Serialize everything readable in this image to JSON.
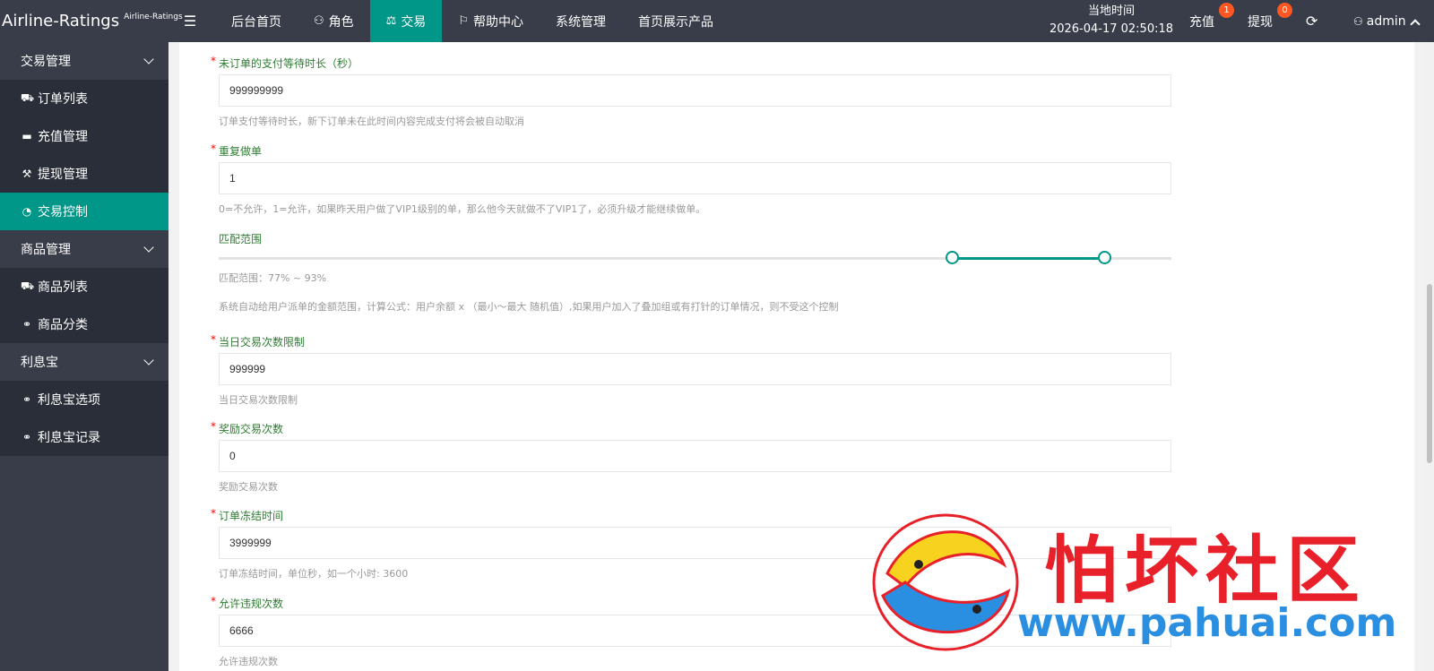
{
  "brand": {
    "title": "Airline-Ratings",
    "subtitle": "Airline-Ratings"
  },
  "nav": [
    {
      "label": "后台首页",
      "icon": ""
    },
    {
      "label": "角色",
      "icon": "user-icon"
    },
    {
      "label": "交易",
      "icon": "scale-icon",
      "active": true
    },
    {
      "label": "帮助中心",
      "icon": "flag-icon"
    },
    {
      "label": "系统管理",
      "icon": ""
    },
    {
      "label": "首页展示产品",
      "icon": ""
    }
  ],
  "clock": {
    "label": "当地时间",
    "value": "2026-04-17 02:50:18"
  },
  "topright": {
    "recharge_label": "充值",
    "recharge_badge": "1",
    "withdraw_label": "提现",
    "withdraw_badge": "0",
    "user": "admin"
  },
  "sidebar": {
    "groups": [
      {
        "label": "交易管理",
        "items": [
          {
            "label": "订单列表",
            "icon": "cart-icon"
          },
          {
            "label": "充值管理",
            "icon": "card-icon"
          },
          {
            "label": "提现管理",
            "icon": "gavel-icon"
          },
          {
            "label": "交易控制",
            "icon": "dashboard-icon",
            "active": true
          }
        ]
      },
      {
        "label": "商品管理",
        "items": [
          {
            "label": "商品列表",
            "icon": "shopping-cart-icon"
          },
          {
            "label": "商品分类",
            "icon": "link-icon"
          }
        ]
      },
      {
        "label": "利息宝",
        "items": [
          {
            "label": "利息宝选项",
            "icon": "link-icon"
          },
          {
            "label": "利息宝记录",
            "icon": "link-icon"
          }
        ]
      }
    ]
  },
  "form": {
    "f1": {
      "label": "未订单的支付等待时长（秒）",
      "value": "999999999",
      "help": "订单支付等待时长，新下订单未在此时间内容完成支付将会被自动取消"
    },
    "f2": {
      "label": "重复做单",
      "value": "1",
      "help": "0=不允许，1=允许，如果昨天用户做了VIP1级别的单，那么他今天就做不了VIP1了，必须升级才能继续做单。"
    },
    "range": {
      "label": "匹配范围",
      "min": 77,
      "max": 93,
      "value_text": "匹配范围：77% ~ 93%",
      "help": "系统自动给用户派单的金额范围，计算公式：用户余额 x （最小～最大 随机值）,如果用户加入了叠加组或有打针的订单情况，则不受这个控制"
    },
    "f3": {
      "label": "当日交易次数限制",
      "value": "999999",
      "help": "当日交易次数限制"
    },
    "f4": {
      "label": "奖励交易次数",
      "value": "0",
      "help": "奖励交易次数"
    },
    "f5": {
      "label": "订单冻结时间",
      "value": "3999999",
      "help": "订单冻结时间，单位秒，如一个小时: 3600"
    },
    "f6": {
      "label": "允许违规次数",
      "value": "6666",
      "help": "允许违规次数"
    }
  },
  "watermark": {
    "title": "怕坏社区",
    "url": "www.pahuai.com"
  },
  "colors": {
    "accent": "#009688",
    "topbar": "#393d49",
    "badge": "#ff5722"
  }
}
